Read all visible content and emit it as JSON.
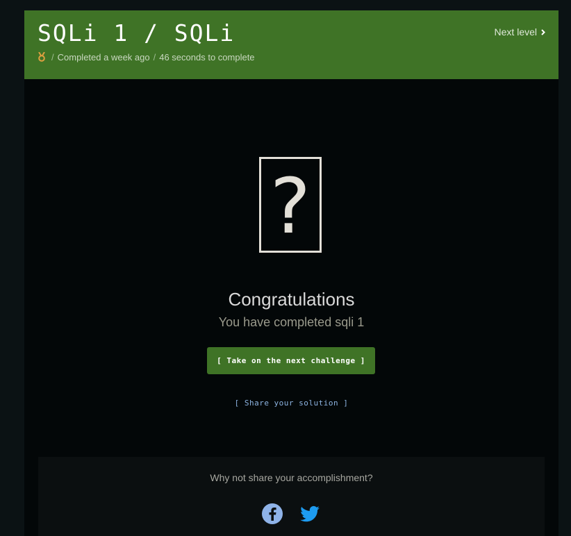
{
  "header": {
    "title": "SQLi 1 / SQLi",
    "medal_icon": "medal-icon",
    "completed_time": "Completed a week ago",
    "separator": "/",
    "duration": "46 seconds to complete",
    "next_level_label": "Next level",
    "background_color": "#3f7326"
  },
  "main": {
    "mystery_glyph": "?",
    "congrats_heading": "Congratulations",
    "completed_message": "You have completed sqli 1",
    "next_challenge_label": "[ Take on the next challenge ]",
    "share_solution_label": "[ Share your solution ]"
  },
  "share": {
    "prompt": "Why not share your accomplishment?",
    "facebook_icon": "facebook-icon",
    "twitter_icon": "twitter-icon",
    "facebook_color": "#8fb3e8",
    "twitter_color": "#1d9bf0"
  }
}
